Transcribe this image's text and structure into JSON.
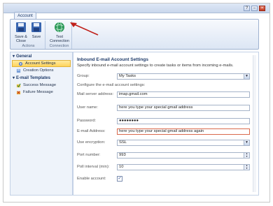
{
  "ribbon": {
    "tab_label": "Account",
    "groups": [
      {
        "label": "Actions",
        "buttons": [
          {
            "label": "Save &\nClose",
            "icon": "save-close-icon"
          },
          {
            "label": "Save",
            "icon": "save-icon"
          }
        ]
      },
      {
        "label": "Connection",
        "buttons": [
          {
            "label": "Test\nConnection",
            "icon": "globe-icon"
          }
        ]
      }
    ]
  },
  "window": {
    "buttons": [
      "?",
      "–",
      "×"
    ]
  },
  "sidebar": {
    "sections": [
      {
        "title": "General",
        "items": [
          {
            "label": "Account Settings",
            "icon": "settings-icon",
            "active": true
          },
          {
            "label": "Creation Options",
            "icon": "options-icon",
            "active": false
          }
        ]
      },
      {
        "title": "E-mail Templates",
        "items": [
          {
            "label": "Success Message",
            "icon": "success-icon",
            "active": false
          },
          {
            "label": "Failure Message",
            "icon": "failure-icon",
            "active": false
          }
        ]
      }
    ]
  },
  "form": {
    "title": "Inbound E-mail Account Settings",
    "description": "Specify inbound e-mail account settings to create tasks or items from incoming e-mails.",
    "group_label": "Group:",
    "group_value": "My Tasks",
    "config_heading": "Configure the e-mail account settings:",
    "fields": {
      "server_label": "Mail server address:",
      "server_value": "imap.gmail.com",
      "user_label": "User name:",
      "user_value": "here you type your special gmail address",
      "password_label": "Password:",
      "password_value": "●●●●●●●●",
      "email_label": "E-mail Address:",
      "email_value": "here you type your special gmail address again",
      "encryption_label": "Use encryption:",
      "encryption_value": "SSL",
      "port_label": "Port number:",
      "port_value": "993",
      "poll_label": "Poll interval (min):",
      "poll_value": "10",
      "enable_label": "Enable account:",
      "enable_checked": true
    }
  },
  "colors": {
    "accent": "#1f3b6a",
    "active_bg": "#ffd35a",
    "error_border": "#d9694c",
    "arrow": "#c0201a"
  }
}
